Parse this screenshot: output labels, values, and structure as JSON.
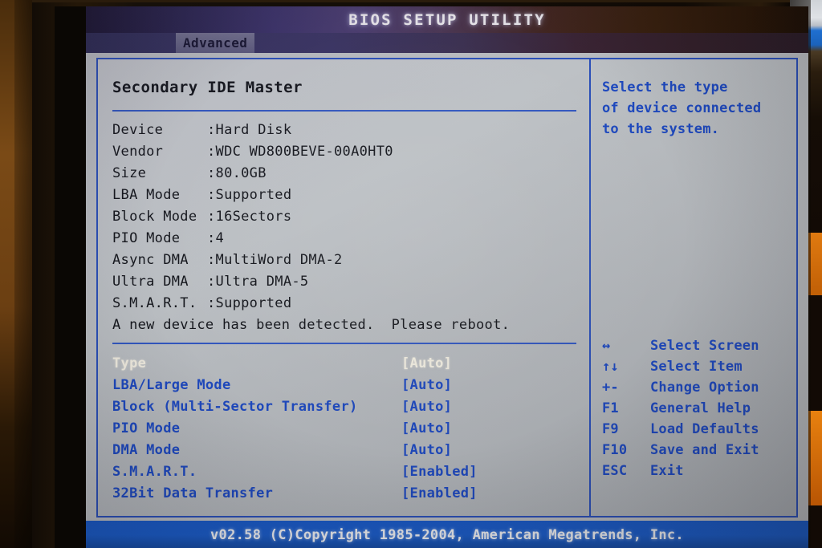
{
  "window": {
    "title": "BIOS SETUP UTILITY"
  },
  "menubar": {
    "active_tab": "Advanced"
  },
  "main": {
    "section_title": "Secondary IDE Master",
    "device_info": [
      {
        "label": "Device",
        "value": ":Hard Disk"
      },
      {
        "label": "Vendor",
        "value": ":WDC WD800BEVE-00A0HT0"
      },
      {
        "label": "Size",
        "value": ":80.0GB"
      },
      {
        "label": "LBA Mode",
        "value": ":Supported"
      },
      {
        "label": "Block Mode",
        "value": ":16Sectors"
      },
      {
        "label": "PIO Mode",
        "value": ":4"
      },
      {
        "label": "Async DMA",
        "value": ":MultiWord DMA-2"
      },
      {
        "label": "Ultra DMA",
        "value": ":Ultra DMA-5"
      },
      {
        "label": "S.M.A.R.T.",
        "value": ":Supported"
      }
    ],
    "detect_note": "A new device has been detected.  Please reboot.",
    "settings": [
      {
        "label": "Type",
        "value": "[Auto]",
        "selected": true
      },
      {
        "label": "LBA/Large Mode",
        "value": "[Auto]",
        "selected": false
      },
      {
        "label": "Block (Multi-Sector Transfer)",
        "value": "[Auto]",
        "selected": false
      },
      {
        "label": "PIO Mode",
        "value": "[Auto]",
        "selected": false
      },
      {
        "label": "DMA Mode",
        "value": "[Auto]",
        "selected": false
      },
      {
        "label": "S.M.A.R.T.",
        "value": "[Enabled]",
        "selected": false
      },
      {
        "label": "32Bit Data Transfer",
        "value": "[Enabled]",
        "selected": false
      }
    ]
  },
  "help": {
    "lines": [
      "Select the type",
      "of device connected",
      "to the system."
    ],
    "keys": [
      {
        "glyph": "↔",
        "icon": "left-right-arrow-icon",
        "desc": "Select Screen"
      },
      {
        "glyph": "↑↓",
        "icon": "up-down-arrow-icon",
        "desc": "Select Item"
      },
      {
        "glyph": "+-",
        "icon": "plus-minus-icon",
        "desc": "Change Option"
      },
      {
        "glyph": "F1",
        "icon": "f1-key-icon",
        "desc": "General Help"
      },
      {
        "glyph": "F9",
        "icon": "f9-key-icon",
        "desc": "Load Defaults"
      },
      {
        "glyph": "F10",
        "icon": "f10-key-icon",
        "desc": "Save and Exit"
      },
      {
        "glyph": "ESC",
        "icon": "esc-key-icon",
        "desc": "Exit"
      }
    ]
  },
  "footer": {
    "copyright": "v02.58  (C)Copyright 1985-2004, American Megatrends, Inc."
  },
  "colors": {
    "screen_bg": "#b9bcc0",
    "accent_blue": "#1e49bf",
    "border_blue": "#2a4fb8",
    "footer_blue": "#1959c6",
    "selected_text": "#f0ece0",
    "body_text": "#14161c"
  }
}
